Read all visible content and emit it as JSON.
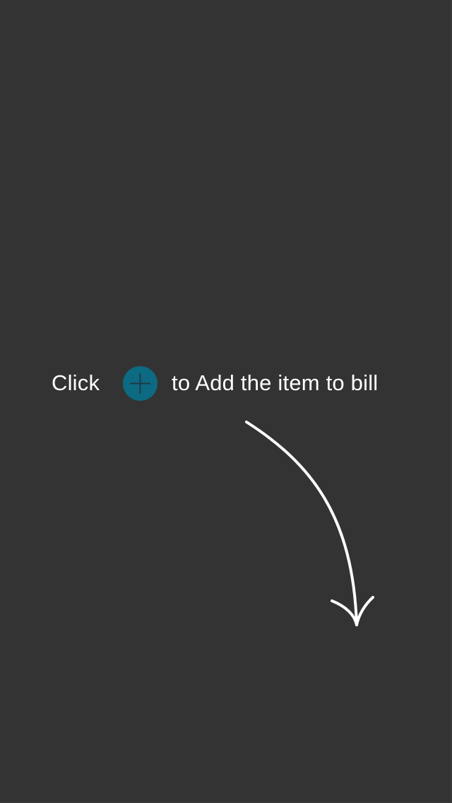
{
  "hint": {
    "prefix": "Click",
    "suffix": "to Add the item to bill",
    "icon": "add-circle-icon"
  },
  "colors": {
    "background": "#333333",
    "text": "#ffffff",
    "accent": "#0c6a83",
    "plus_glyph": "#1f3a44"
  }
}
